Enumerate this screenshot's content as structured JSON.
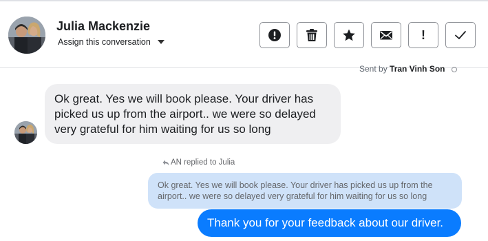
{
  "contact": {
    "name": "Julia Mackenzie",
    "assign_label": "Assign this conversation"
  },
  "toolbar": {
    "buttons": [
      {
        "icon": "alert-circle-icon"
      },
      {
        "icon": "trash-icon"
      },
      {
        "icon": "star-icon"
      },
      {
        "icon": "envelope-icon"
      },
      {
        "icon": "exclamation-icon",
        "glyph": "!"
      },
      {
        "icon": "checkmark-icon"
      }
    ]
  },
  "sent_by": {
    "prefix": "Sent by",
    "agent": "Tran Vinh Son"
  },
  "messages": {
    "incoming": "Ok great. Yes we will book please. Your driver has picked us up from the airport.. we were so delayed very grateful for him waiting for us so long",
    "reply_label": "AN replied to Julia",
    "quoted": "Ok great. Yes we will book please. Your driver has picked us up from the airport.. we were so delayed very grateful for him waiting for us so long",
    "outgoing": "Thank you for your feedback about our driver."
  },
  "colors": {
    "outgoing_bubble": "#0a7cff",
    "incoming_bubble": "#efeff1",
    "quote_bubble": "#cfe2f9"
  }
}
